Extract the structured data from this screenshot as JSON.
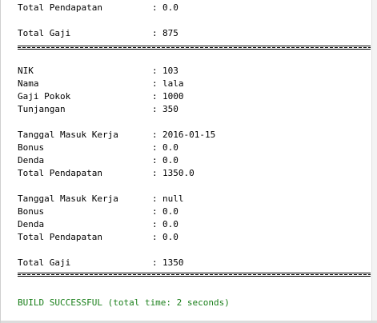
{
  "output": {
    "separator": ":",
    "top_block": {
      "total_pendapatan": {
        "label": "Total Pendapatan",
        "value": "0.0"
      },
      "total_gaji": {
        "label": "Total Gaji",
        "value": "875"
      }
    },
    "employee": {
      "nik": {
        "label": "NIK",
        "value": "103"
      },
      "nama": {
        "label": "Nama",
        "value": "lala"
      },
      "gaji_pokok": {
        "label": "Gaji Pokok",
        "value": "1000"
      },
      "tunjangan": {
        "label": "Tunjangan",
        "value": "350"
      }
    },
    "entry1": {
      "tanggal": {
        "label": "Tanggal Masuk Kerja",
        "value": "2016-01-15"
      },
      "bonus": {
        "label": "Bonus",
        "value": "0.0"
      },
      "denda": {
        "label": "Denda",
        "value": "0.0"
      },
      "total": {
        "label": "Total Pendapatan",
        "value": "1350.0"
      }
    },
    "entry2": {
      "tanggal": {
        "label": "Tanggal Masuk Kerja",
        "value": "null"
      },
      "bonus": {
        "label": "Bonus",
        "value": "0.0"
      },
      "denda": {
        "label": "Denda",
        "value": "0.0"
      },
      "total": {
        "label": "Total Pendapatan",
        "value": "0.0"
      }
    },
    "final": {
      "total_gaji": {
        "label": "Total Gaji",
        "value": "1350"
      }
    },
    "build_status": "BUILD SUCCESSFUL (total time: 2 seconds)",
    "colors": {
      "success": "#1a7f1a",
      "background": "#ffffff",
      "text": "#000000"
    }
  }
}
